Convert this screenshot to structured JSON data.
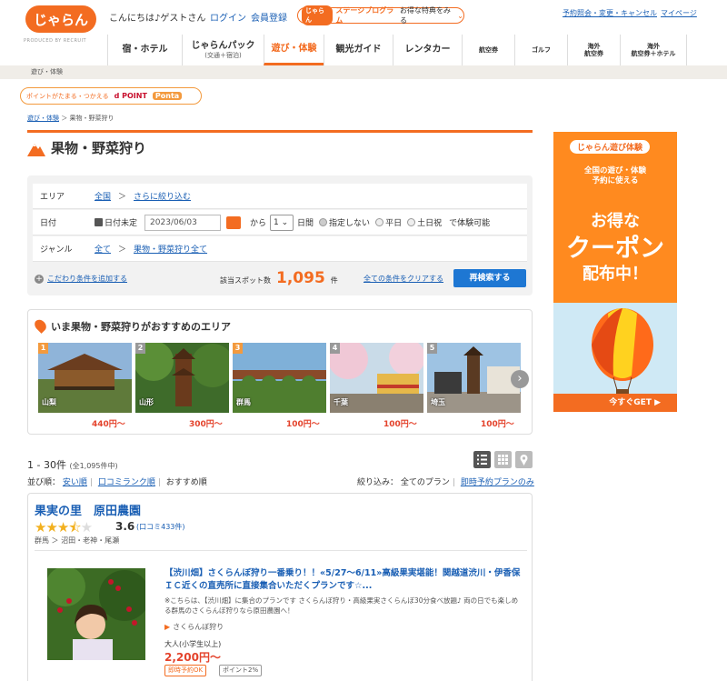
{
  "header": {
    "logo": "じゃらん",
    "logo_sub": "PRODUCED BY RECRUIT",
    "greeting": "こんにちは♪ゲストさん",
    "login": "ログイン",
    "register": "会員登録",
    "stage_logo": "じゃらん",
    "stage_program": "ステージプログラム",
    "stage_benefit": "お得な特典をみる",
    "util_links": [
      "予約照会・変更・キャンセル",
      "マイページ"
    ]
  },
  "nav": {
    "items": [
      {
        "label": "宿・ホテル",
        "sub": ""
      },
      {
        "label": "じゃらんパック",
        "sub": "(交通＋宿泊)"
      },
      {
        "label": "遊び・体験",
        "sub": ""
      },
      {
        "label": "観光ガイド",
        "sub": ""
      },
      {
        "label": "レンタカー",
        "sub": ""
      },
      {
        "label": "航空券",
        "sub": ""
      },
      {
        "label": "ゴルフ",
        "sub": ""
      },
      {
        "label": "海外",
        "sub": "航空券"
      },
      {
        "label": "海外",
        "sub": "航空券＋ホテル"
      }
    ],
    "active_index": 2
  },
  "category_bar": "遊び・体験",
  "points_banner": {
    "text": "ポイントがたまる・つかえる",
    "dpoint": "d POINT",
    "ponta": "Ponta"
  },
  "breadcrumb": {
    "root": "遊び・体験",
    "current": "果物・野菜狩り"
  },
  "page_title": "果物・野菜狩り",
  "search": {
    "area_label": "エリア",
    "area_value": "全国",
    "area_refine": "さらに絞り込む",
    "date_label": "日付",
    "date_unset": "日付未定",
    "date_value": "2023/06/03",
    "from": "から",
    "days": "1",
    "days_unit": "日間",
    "radio_none": "指定しない",
    "radio_weekday": "平日",
    "radio_holiday": "土日祝",
    "availability": "で体験可能",
    "genre_label": "ジャンル",
    "genre_all": "全て",
    "genre_value": "果物・野菜狩り全て",
    "add_condition": "こだわり条件を追加する",
    "count_label": "該当スポット数",
    "count": "1,095",
    "count_unit": "件",
    "clear_all": "全ての条件をクリアする",
    "research": "再検索する"
  },
  "recommended": {
    "title": "いま果物・野菜狩りがおすすめのエリア",
    "areas": [
      {
        "rank": "1",
        "pref": "山梨",
        "price": "440円〜"
      },
      {
        "rank": "2",
        "pref": "山形",
        "price": "300円〜"
      },
      {
        "rank": "3",
        "pref": "群馬",
        "price": "100円〜"
      },
      {
        "rank": "4",
        "pref": "千葉",
        "price": "100円〜"
      },
      {
        "rank": "5",
        "pref": "埼玉",
        "price": "100円〜"
      }
    ]
  },
  "listing": {
    "range": "1 - 30件",
    "total": "(全1,095件中)",
    "sort_label": "並び順：",
    "sort_cheap": "安い順",
    "sort_reviews": "口コミランク順",
    "sort_recommended": "おすすめ順",
    "filter_label": "絞り込み：",
    "filter_all": "全てのプラン",
    "filter_instant": "即時予約プランのみ"
  },
  "result": {
    "name": "果実の里　原田農園",
    "rating": "3.6",
    "rating_value": 3.6,
    "reviews": "(口コミ433件)",
    "location": "群馬 ＞ 沼田・老神・尾瀬",
    "plan_title": "【渋川畑】さくらんぼ狩り一番乗り！！«5/27〜6/11»高級果実堪能！関越道渋川・伊香保ＩＣ近くの直売所に直接集合いただくプランです☆...",
    "description": "※こちらは、【渋川畑】に集合のプランです さくらんぼ狩り・高級果実さくらんぼ30分食べ放題♪ 両の日でも楽しめる群馬のさくらんぼ狩りなら原田農園へ！",
    "category": "さくらんぼ狩り",
    "adult_label": "大人(小学生以上)",
    "price": "2,200円〜",
    "tags": [
      "即時予約OK",
      "ポイント2%"
    ]
  },
  "ad": {
    "logo": "じゃらん遊び体験",
    "line1": "全国の遊び・体験",
    "line2": "予約に使える",
    "big1": "お得な",
    "big2": "クーポン",
    "big3": "配布中！",
    "cta": "今すぐGET"
  },
  "colors": {
    "accent": "#f36c21",
    "link": "#1a5fb4",
    "price": "#e4432c",
    "button": "#1e77d3"
  }
}
